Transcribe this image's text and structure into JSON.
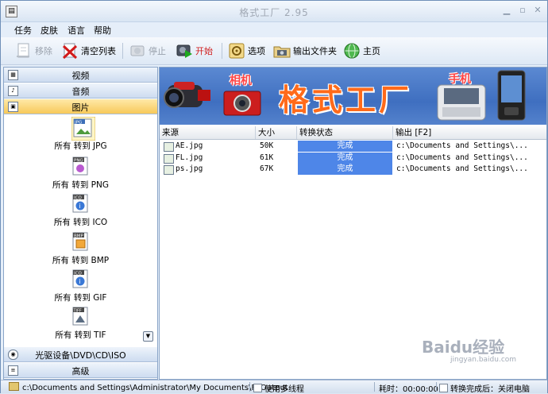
{
  "window": {
    "title": "格式工厂 2.95"
  },
  "menu": [
    "任务",
    "皮肤",
    "语言",
    "帮助"
  ],
  "toolbar": {
    "remove": "移除",
    "clear_list": "清空列表",
    "stop": "停止",
    "start": "开始",
    "options": "选项",
    "output_folder": "输出文件夹",
    "home": "主页"
  },
  "categories": {
    "video": "视频",
    "audio": "音频",
    "image": "图片",
    "rom": "光驱设备\\DVD\\CD\\ISO",
    "advanced": "高级"
  },
  "image_tools": [
    {
      "format": "JPG",
      "label": "所有 转到 JPG"
    },
    {
      "format": "PNG",
      "label": "所有 转到 PNG"
    },
    {
      "format": "ICO",
      "label": "所有 转到 ICO"
    },
    {
      "format": "BMP",
      "label": "所有 转到 BMP"
    },
    {
      "format": "ICO",
      "label": "所有 转到 GIF"
    },
    {
      "format": "TIFF",
      "label": "所有 转到 TIF"
    }
  ],
  "banner": {
    "title": "格式工厂",
    "tag_camera": "相机",
    "tag_phone": "手机"
  },
  "table": {
    "headers": [
      "来源",
      "大小",
      "转换状态",
      "输出 [F2]"
    ],
    "rows": [
      {
        "source": "AE.jpg",
        "size": "50K",
        "status": "完成",
        "output": "c:\\Documents and Settings\\..."
      },
      {
        "source": "FL.jpg",
        "size": "61K",
        "status": "完成",
        "output": "c:\\Documents and Settings\\..."
      },
      {
        "source": "ps.jpg",
        "size": "67K",
        "status": "完成",
        "output": "c:\\Documents and Settings\\..."
      }
    ]
  },
  "statusbar": {
    "path": "c:\\Documents and Settings\\Administrator\\My Documents\\FFOutput",
    "multithread": "使用多线程",
    "elapsed": "耗时：00:00:00",
    "after_done": "转换完成后：关闭电脑"
  },
  "watermark": {
    "main": "Baidu经验",
    "sub": "jingyan.baidu.com"
  },
  "colors": {
    "accent": "#4e86e8",
    "banner_text": "#ff6a1a",
    "active_category": "#f7c95a"
  }
}
